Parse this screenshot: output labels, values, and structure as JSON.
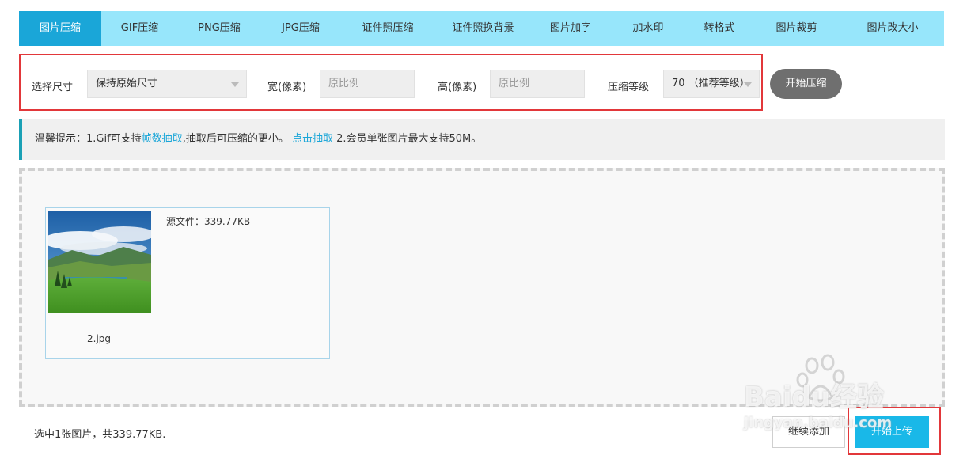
{
  "tabs": [
    {
      "label": "图片压缩",
      "active": true
    },
    {
      "label": "GIF压缩"
    },
    {
      "label": "PNG压缩"
    },
    {
      "label": "JPG压缩"
    },
    {
      "label": "证件照压缩"
    },
    {
      "label": "证件照换背景"
    },
    {
      "label": "图片加字"
    },
    {
      "label": "加水印"
    },
    {
      "label": "转格式"
    },
    {
      "label": "图片裁剪"
    },
    {
      "label": "图片改大小"
    }
  ],
  "options": {
    "size_label": "选择尺寸",
    "size_value": "保持原始尺寸",
    "width_label": "宽(像素)",
    "width_placeholder": "原比例",
    "height_label": "高(像素)",
    "height_placeholder": "原比例",
    "level_label": "压缩等级",
    "level_value": "70 （推荐等级）",
    "start_button": "开始压缩"
  },
  "tip": {
    "prefix": "温馨提示：1.Gif可支持",
    "link1": "帧数抽取",
    "middle": ",抽取后可压缩的更小。 ",
    "link2": "点击抽取",
    "suffix": " 2.会员单张图片最大支持50M。"
  },
  "file": {
    "source_size": "源文件：339.77KB",
    "name": "2.jpg"
  },
  "footer": {
    "summary": "选中1张图片，共339.77KB.",
    "continue_button": "继续添加",
    "upload_button": "开始上传"
  },
  "watermark": {
    "brand": "Baidu经验",
    "url": "jingyan.baidu.com"
  },
  "colors": {
    "tab_bar": "#97e6fb",
    "tab_active": "#1aa6d8",
    "highlight_box": "#e2373a",
    "upload_button": "#19b8e8",
    "link": "#1aa6d8"
  }
}
